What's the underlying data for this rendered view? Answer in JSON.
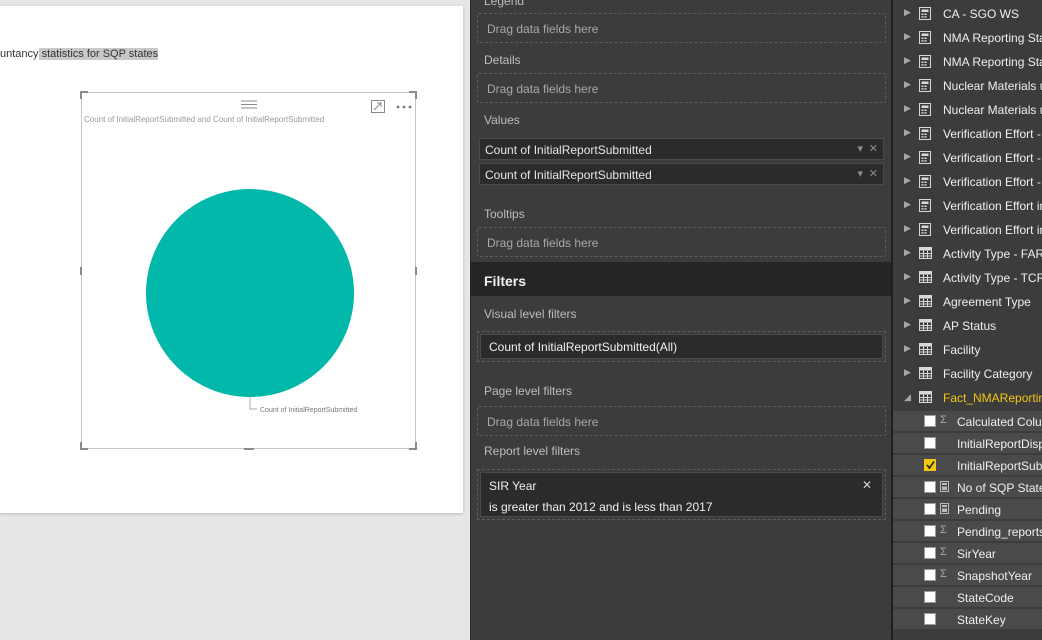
{
  "canvas": {
    "textbox_prefix": "untancy",
    "textbox_highlight": " statistics for SQP states",
    "visual": {
      "title": "Count of InitialReportSubmitted and Count of InitialReportSubmitted",
      "legend_label": "Count of InitialReportSubmitted",
      "pie_color": "#01b8aa",
      "focus_icon": "focus-mode-icon",
      "more_icon": "more-options-icon"
    }
  },
  "viz_pane": {
    "legend": {
      "label": "Legend",
      "placeholder": "Drag data fields here"
    },
    "details": {
      "label": "Details",
      "placeholder": "Drag data fields here"
    },
    "values": {
      "label": "Values",
      "items": [
        "Count of InitialReportSubmitted",
        "Count of InitialReportSubmitted"
      ]
    },
    "tooltips": {
      "label": "Tooltips",
      "placeholder": "Drag data fields here"
    },
    "filters_title": "Filters",
    "visual_level": {
      "label": "Visual level filters",
      "item": "Count of InitialReportSubmitted(All)"
    },
    "page_level": {
      "label": "Page level filters",
      "placeholder": "Drag data fields here"
    },
    "report_level": {
      "label": "Report level filters",
      "field": "SIR Year",
      "condition": "is greater than 2012 and is less than 2017"
    }
  },
  "fields_pane": {
    "tables": [
      {
        "name": "CA - SGO WS",
        "icon": "calculator-icon"
      },
      {
        "name": "NMA Reporting Sta",
        "icon": "calculator-icon"
      },
      {
        "name": "NMA Reporting Sta",
        "icon": "calculator-icon"
      },
      {
        "name": "Nuclear Materials u",
        "icon": "calculator-icon"
      },
      {
        "name": "Nuclear Materials u",
        "icon": "calculator-icon"
      },
      {
        "name": "Verification Effort -",
        "icon": "calculator-icon"
      },
      {
        "name": "Verification Effort -",
        "icon": "calculator-icon"
      },
      {
        "name": "Verification Effort -",
        "icon": "calculator-icon"
      },
      {
        "name": "Verification Effort in",
        "icon": "calculator-icon"
      },
      {
        "name": "Verification Effort in",
        "icon": "calculator-icon"
      },
      {
        "name": "Activity Type - FAR",
        "icon": "table-icon"
      },
      {
        "name": "Activity Type - TCR",
        "icon": "table-icon"
      },
      {
        "name": "Agreement Type",
        "icon": "table-icon"
      },
      {
        "name": "AP Status",
        "icon": "table-icon"
      },
      {
        "name": "Facility",
        "icon": "table-icon"
      },
      {
        "name": "Facility Category",
        "icon": "table-icon"
      }
    ],
    "expanded_table": {
      "name": "Fact_NMAReporting",
      "color": "#f2c811"
    },
    "fields": [
      {
        "name": "Calculated Colun",
        "type": "sigma",
        "checked": false
      },
      {
        "name": "InitialReportDisp",
        "type": "none",
        "checked": false
      },
      {
        "name": "InitialReportSubr",
        "type": "none",
        "checked": true
      },
      {
        "name": "No of SQP State",
        "type": "calculator",
        "checked": false
      },
      {
        "name": "Pending",
        "type": "calculator",
        "checked": false
      },
      {
        "name": "Pending_reports",
        "type": "sigma",
        "checked": false
      },
      {
        "name": "SirYear",
        "type": "sigma",
        "checked": false
      },
      {
        "name": "SnapshotYear",
        "type": "sigma",
        "checked": false
      },
      {
        "name": "StateCode",
        "type": "none",
        "checked": false
      },
      {
        "name": "StateKey",
        "type": "none",
        "checked": false
      }
    ]
  }
}
